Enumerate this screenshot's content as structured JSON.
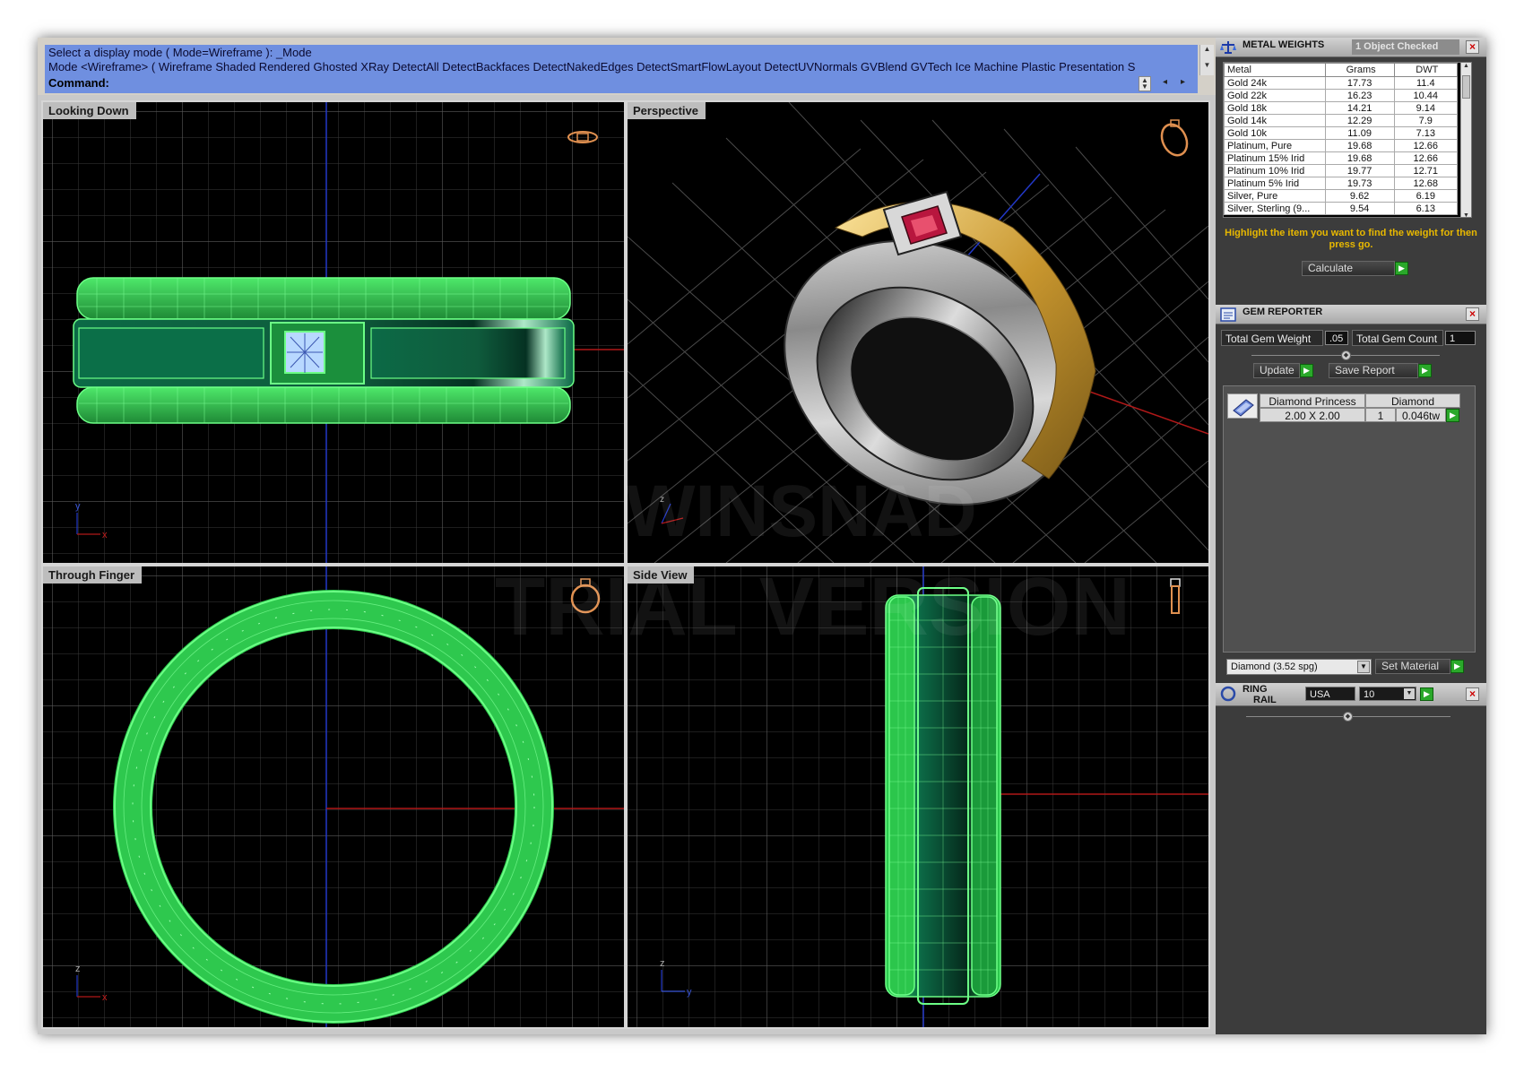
{
  "command": {
    "history_line1": "Select a display mode ( Mode=Wireframe ): _Mode",
    "history_line2": "Mode <Wireframe> ( Wireframe  Shaded  Rendered  Ghosted  XRay  DetectAll  DetectBackfaces  DetectNakedEdges  DetectSmartFlowLayout  DetectUVNormals  GVBlend  GVTech  Ice  Machine  Plastic  Presentation  S",
    "prompt": "Command:"
  },
  "viewports": {
    "top_left": "Looking Down",
    "top_right": "Perspective",
    "bottom_left": "Through Finger",
    "bottom_right": "Side View"
  },
  "axes": {
    "x": "x",
    "y": "y",
    "z": "z"
  },
  "watermark": {
    "line1": "WINSNAD",
    "line2": "TRIAL VERSION"
  },
  "metal_weights": {
    "title": "METAL WEIGHTS",
    "status": "1 Object Checked",
    "columns": [
      "Metal",
      "Grams",
      "DWT"
    ],
    "rows": [
      [
        "Gold 24k",
        "17.73",
        "11.4"
      ],
      [
        "Gold 22k",
        "16.23",
        "10.44"
      ],
      [
        "Gold 18k",
        "14.21",
        "9.14"
      ],
      [
        "Gold 14k",
        "12.29",
        "7.9"
      ],
      [
        "Gold 10k",
        "11.09",
        "7.13"
      ],
      [
        "Platinum, Pure",
        "19.68",
        "12.66"
      ],
      [
        "Platinum 15% Irid",
        "19.68",
        "12.66"
      ],
      [
        "Platinum 10% Irid",
        "19.77",
        "12.71"
      ],
      [
        "Platinum 5% Irid",
        "19.73",
        "12.68"
      ],
      [
        "Silver, Pure",
        "9.62",
        "6.19"
      ],
      [
        "Silver, Sterling (9...",
        "9.54",
        "6.13"
      ]
    ],
    "hint": "Highlight the item you want to find the weight for then press go.",
    "calculate_label": "Calculate"
  },
  "gem_reporter": {
    "title": "GEM REPORTER",
    "total_weight_label": "Total Gem Weight",
    "total_weight_value": ".05",
    "total_count_label": "Total Gem Count",
    "total_count_value": "1",
    "update_label": "Update",
    "save_report_label": "Save Report",
    "gem": {
      "shape": "Diamond Princess",
      "material": "Diamond",
      "size": "2.00 X 2.00",
      "count": "1",
      "weight": "0.046tw"
    },
    "material_select": "Diamond    (3.52 spg)",
    "set_material_label": "Set Material"
  },
  "ring_rail": {
    "title_line1": "RING",
    "title_line2": "RAIL",
    "country": "USA",
    "size": "10"
  },
  "colors": {
    "command_bg": "#6f8fe0",
    "wire_green": "#39e05a",
    "hint_yellow": "#e8b800",
    "go_green": "#2aa82a",
    "gold": "#d9b04a",
    "ruby": "#c0184a"
  }
}
